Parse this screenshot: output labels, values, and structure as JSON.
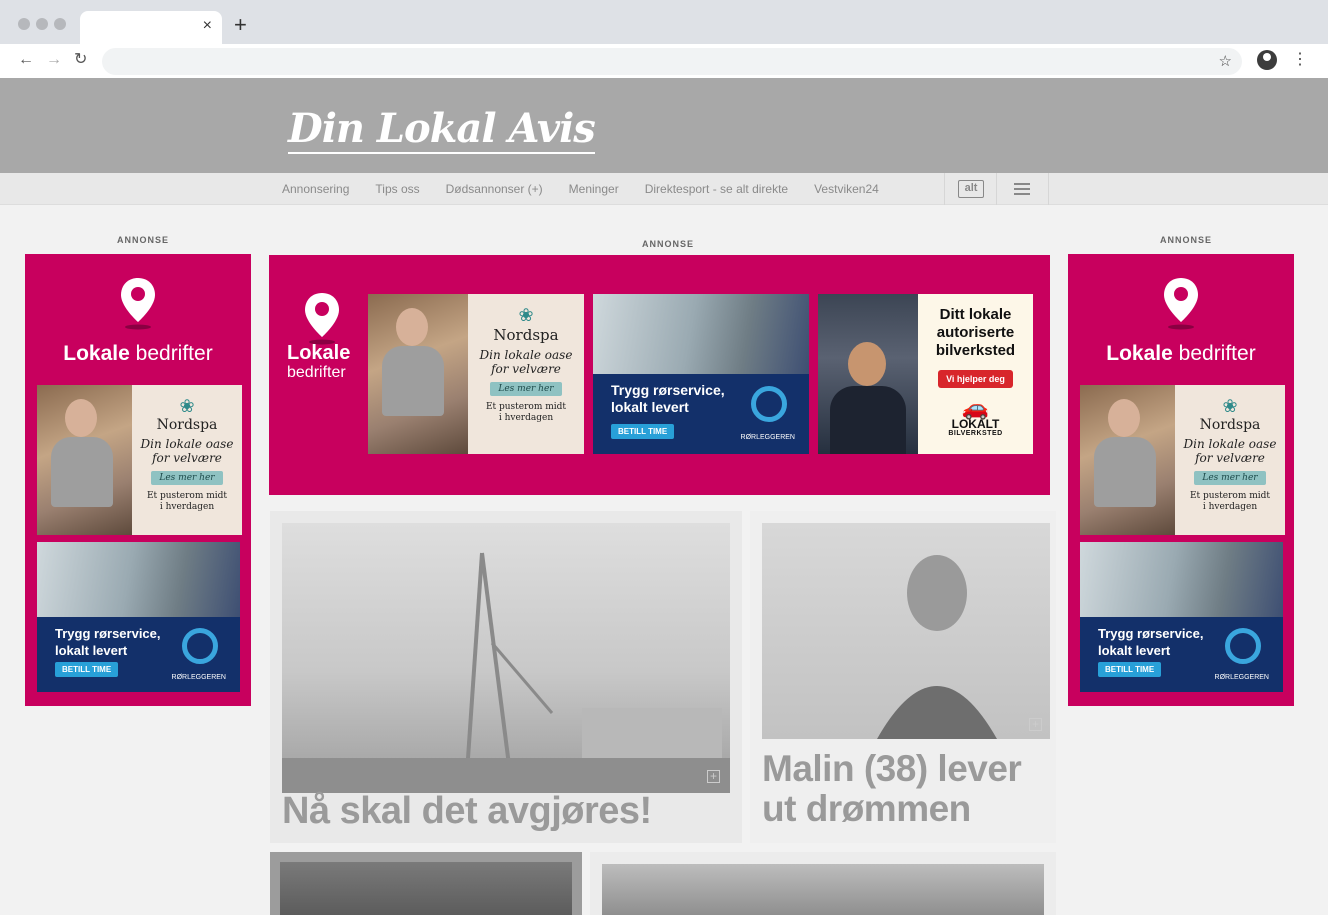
{
  "browser": {
    "tab_close": "×",
    "new_tab": "+",
    "back": "←",
    "forward": "→",
    "reload": "↻",
    "bookmark": "☆",
    "menu": "⋮"
  },
  "site": {
    "logo": "Din Lokal Avis"
  },
  "nav": {
    "items": [
      "Annonsering",
      "Tips oss",
      "Dødsannonser (+)",
      "Meninger",
      "Direktesport - se alt direkte",
      "Vestviken24"
    ],
    "alt_label": "alt"
  },
  "ads": {
    "label": "ANNONSE",
    "brand_bold": "Lokale",
    "brand_light": "bedrifter",
    "spa": {
      "name": "Nordspa",
      "tagline_1": "Din lokale oase",
      "tagline_2": "for velvære",
      "button": "Les mer her",
      "sub_1": "Et pusterom midt",
      "sub_2": "i hverdagen"
    },
    "plumber": {
      "line_1": "Trygg rørservice,",
      "line_2": "lokalt levert",
      "button": "BETILL TIME",
      "brand": "RØRLEGGEREN"
    },
    "car": {
      "line_1": "Ditt lokale",
      "line_2": "autoriserte",
      "line_3": "bilverksted",
      "button": "Vi hjelper deg",
      "brand": "LOKALT",
      "brand_sub": "BILVERKSTED"
    }
  },
  "articles": [
    {
      "headline": "Nå skal det avgjøres!"
    },
    {
      "headline_1": "Malin (38) lever",
      "headline_2": "ut drømmen"
    }
  ],
  "colors": {
    "ad_magenta": "#c8005e",
    "plumber_navy": "#13306a",
    "masthead_gray": "#a8a8a8"
  }
}
